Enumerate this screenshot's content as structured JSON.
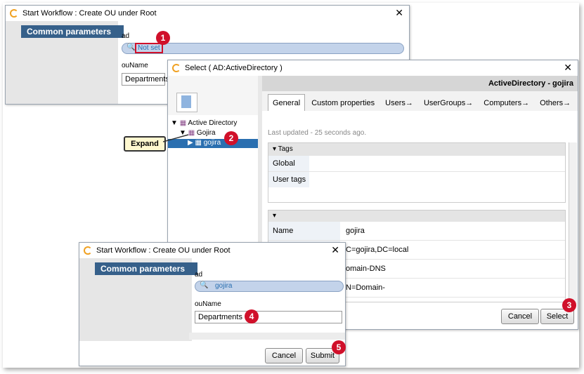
{
  "win1": {
    "title": "Start Workflow : Create OU under Root",
    "section": "Common parameters",
    "ad_label": "ad",
    "ad_value": "Not set",
    "ou_label": "ouName",
    "ou_value": "Departments"
  },
  "win2": {
    "title": "Select ( AD:ActiveDirectory  )",
    "header": "ActiveDirectory - gojira",
    "tabs": [
      "General",
      "Custom properties",
      "Users→",
      "UserGroups→",
      "Computers→",
      "Others→"
    ],
    "tree": [
      "Active Directory",
      "Gojira",
      "gojira"
    ],
    "updated": "Last updated - 25 seconds ago.",
    "tags_header": "Tags",
    "tags": [
      {
        "label": "Global tags",
        "value": ""
      },
      {
        "label": "User tags",
        "value": ""
      }
    ],
    "props": [
      {
        "label": "Name",
        "value": "gojira"
      },
      {
        "label": "",
        "value": "C=gojira,DC=local"
      },
      {
        "label": "",
        "value": "omain-DNS"
      },
      {
        "label": "",
        "value": "N=Domain-DNS,CN=Schema,CN=Configuration,DC=gojira,DC=local"
      }
    ],
    "cancel": "Cancel",
    "select": "Select"
  },
  "win3": {
    "title": "Start Workflow : Create OU under Root",
    "section": "Common parameters",
    "ad_label": "ad",
    "ad_value": "gojira",
    "ou_label": "ouName",
    "ou_value": "Departments",
    "cancel": "Cancel",
    "submit": "Submit"
  },
  "callout": "Expand",
  "badges": [
    "1",
    "2",
    "3",
    "4",
    "5"
  ],
  "colors": {
    "section_bg": "#36608a",
    "badge": "#d0102a",
    "highlight": "#2a6fb0"
  }
}
